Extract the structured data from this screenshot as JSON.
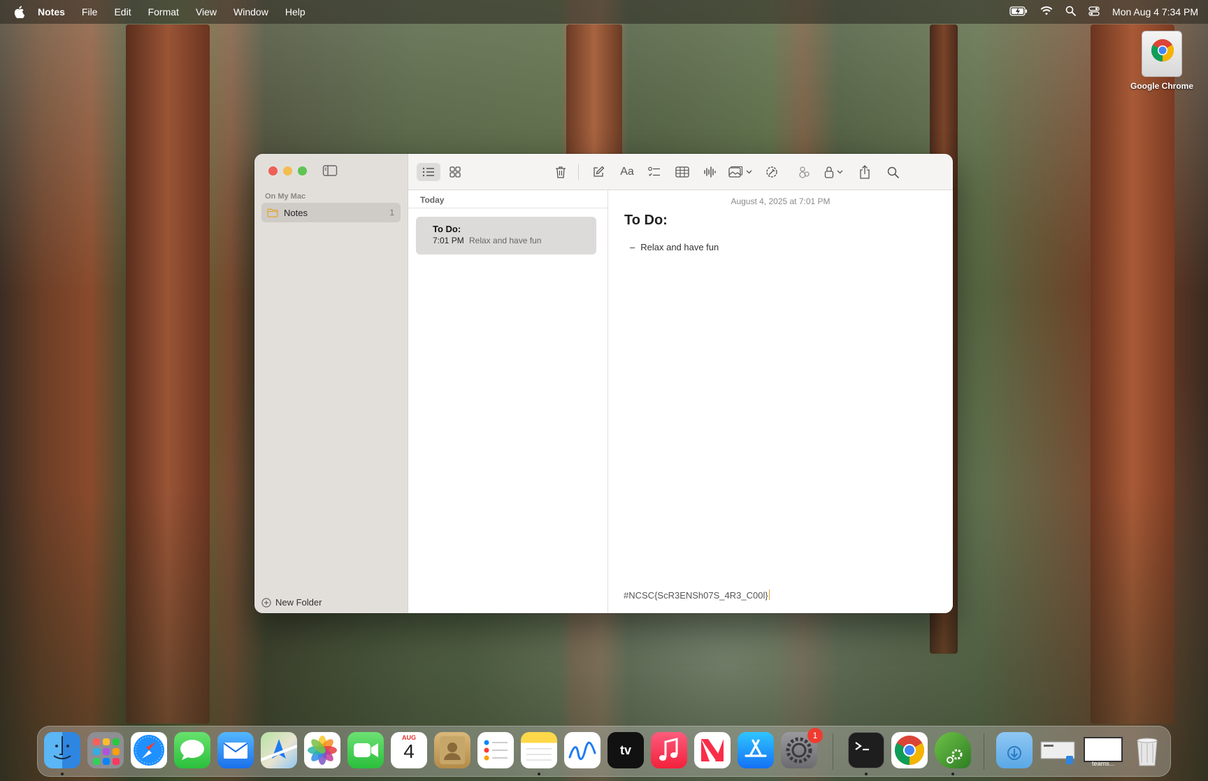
{
  "menubar": {
    "app_name": "Notes",
    "menus": [
      "File",
      "Edit",
      "Format",
      "View",
      "Window",
      "Help"
    ],
    "clock": "Mon Aug 4  7:34 PM"
  },
  "desktop": {
    "icons": [
      {
        "label": "Google Chrome",
        "icon": "chrome-icon"
      }
    ]
  },
  "window": {
    "sidebar": {
      "section_label": "On My Mac",
      "folders": [
        {
          "label": "Notes",
          "count": "1"
        }
      ],
      "new_folder_label": "New Folder"
    },
    "list": {
      "group_header": "Today",
      "notes": [
        {
          "title": "To Do:",
          "time": "7:01 PM",
          "preview": "Relax and have fun"
        }
      ]
    },
    "editor": {
      "date": "August 4, 2025 at 7:01 PM",
      "title": "To Do:",
      "bullets": [
        "Relax and have fun"
      ],
      "footer_text": "#NCSC{ScR3ENSh07S_4R3_C00l}"
    }
  },
  "dock": {
    "apps": [
      {
        "name": "Finder",
        "icon": "finder-icon",
        "running": true
      },
      {
        "name": "Launchpad",
        "icon": "launchpad-icon",
        "running": false
      },
      {
        "name": "Safari",
        "icon": "safari-icon",
        "running": false
      },
      {
        "name": "Messages",
        "icon": "messages-icon",
        "running": false
      },
      {
        "name": "Mail",
        "icon": "mail-icon",
        "running": false
      },
      {
        "name": "Maps",
        "icon": "maps-icon",
        "running": false
      },
      {
        "name": "Photos",
        "icon": "photos-icon",
        "running": false
      },
      {
        "name": "FaceTime",
        "icon": "facetime-icon",
        "running": false
      },
      {
        "name": "Calendar",
        "icon": "calendar-icon",
        "running": false,
        "month": "AUG",
        "day": "4"
      },
      {
        "name": "Contacts",
        "icon": "contacts-icon",
        "running": false
      },
      {
        "name": "Reminders",
        "icon": "reminders-icon",
        "running": false
      },
      {
        "name": "Notes",
        "icon": "notes-icon",
        "running": true
      },
      {
        "name": "Freeform",
        "icon": "freeform-icon",
        "running": false
      },
      {
        "name": "TV",
        "icon": "tv-icon",
        "running": false
      },
      {
        "name": "Music",
        "icon": "music-icon",
        "running": false
      },
      {
        "name": "News",
        "icon": "news-icon",
        "running": false
      },
      {
        "name": "App Store",
        "icon": "app-store-icon",
        "running": false
      },
      {
        "name": "System Settings",
        "icon": "settings-icon",
        "running": false,
        "badge": "1"
      },
      {
        "name": "Terminal",
        "icon": "terminal-icon",
        "running": true
      },
      {
        "name": "Google Chrome",
        "icon": "chrome-icon",
        "running": false
      },
      {
        "name": "Script Editor",
        "icon": "script-icon",
        "running": true
      },
      {
        "name": "Downloads",
        "icon": "downloads-folder-icon",
        "running": false
      },
      {
        "name": "Screenshot",
        "icon": "screenshot-thumb-icon",
        "running": false
      },
      {
        "name": "teams",
        "icon": "teams-thumb-icon",
        "running": false,
        "label": "teams..."
      },
      {
        "name": "Trash",
        "icon": "trash-icon",
        "running": false
      }
    ]
  },
  "colors": {
    "close": "#ee5f57",
    "minimize": "#f4bd4f",
    "maximize": "#5fc454",
    "folder_icon": "#e0a82e"
  }
}
